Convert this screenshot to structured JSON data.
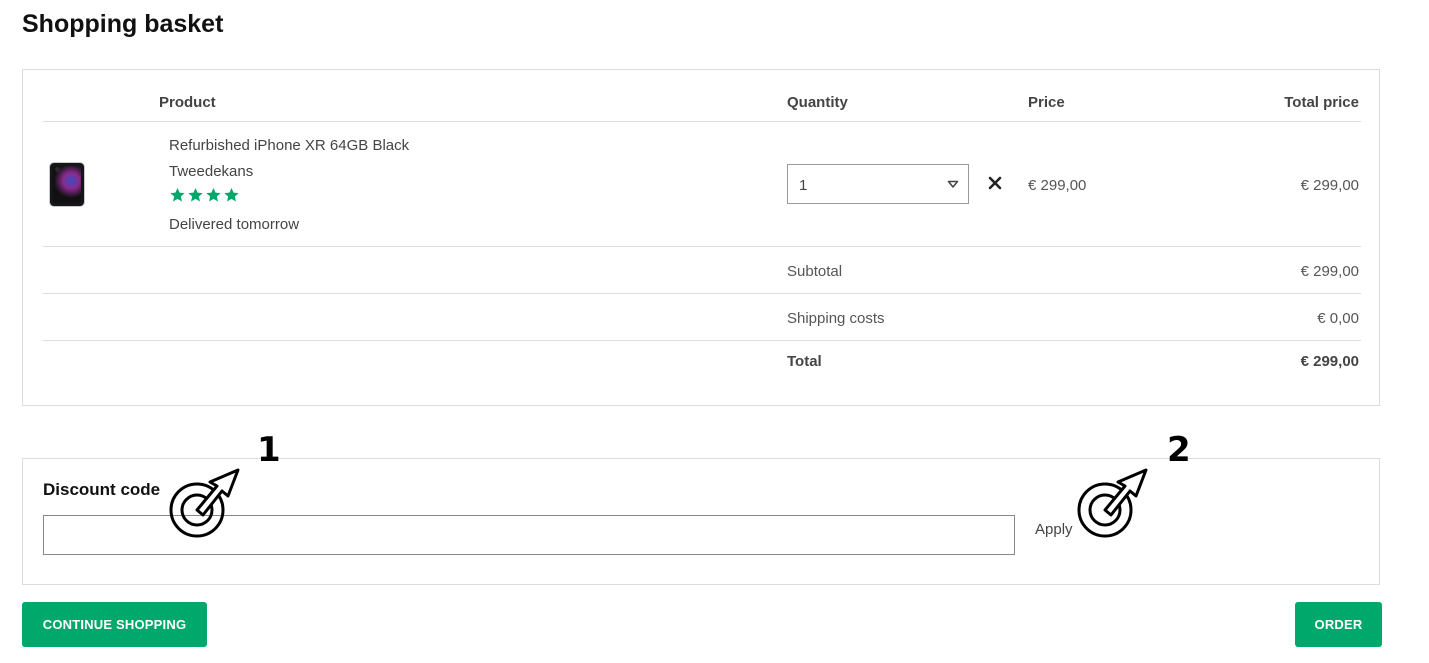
{
  "page": {
    "title": "Shopping basket"
  },
  "table": {
    "headers": {
      "product": "Product",
      "quantity": "Quantity",
      "price": "Price",
      "total_price": "Total price"
    }
  },
  "item": {
    "name": "Refurbished iPhone XR 64GB Black",
    "seller": "Tweedekans",
    "rating_stars": 4,
    "delivery": "Delivered tomorrow",
    "quantity": "1",
    "price": "€ 299,00",
    "total_price": "€ 299,00",
    "image_icon": "phone-product-image",
    "remove_icon": "close-icon"
  },
  "summary": {
    "subtotal_label": "Subtotal",
    "subtotal_value": "€ 299,00",
    "shipping_label": "Shipping costs",
    "shipping_value": "€ 0,00",
    "total_label": "Total",
    "total_value": "€ 299,00"
  },
  "discount": {
    "label": "Discount code",
    "value": "",
    "apply_label": "Apply"
  },
  "annotations": [
    {
      "number": "1"
    },
    {
      "number": "2"
    }
  ],
  "buttons": {
    "continue_label": "CONTINUE SHOPPING",
    "order_label": "ORDER"
  },
  "colors": {
    "accent": "#00a86b",
    "star": "#00a86b",
    "text": "#444444",
    "border": "#dcdcdc"
  }
}
